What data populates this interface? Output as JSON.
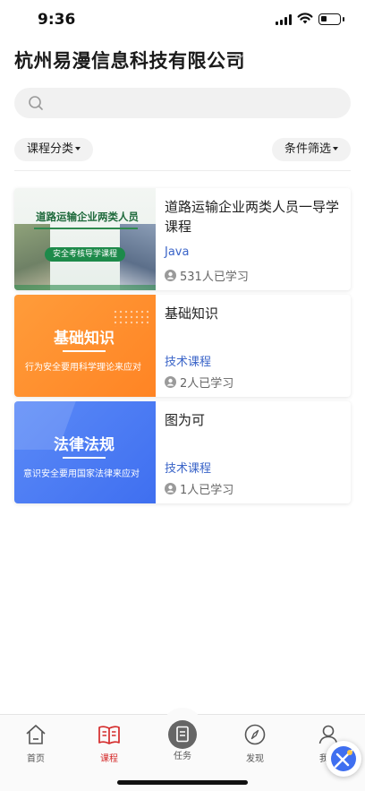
{
  "status_bar": {
    "time": "9:36",
    "battery_level": 0.35
  },
  "header": {
    "company_name": "杭州易漫信息科技有限公司",
    "chevron_icon": "chevron-down-icon"
  },
  "search": {
    "icon": "search-icon"
  },
  "filters": {
    "category_label": "课程分类",
    "condition_label": "条件筛选"
  },
  "courses": [
    {
      "title": "道路运输企业两类人员一导学课程",
      "tag": "Java",
      "learners": "531人已学习",
      "thumb_heading": "道路运输企业两类人员",
      "thumb_pill": "安全考核导学课程"
    },
    {
      "title": "基础知识",
      "tag": "技术课程",
      "learners": "2人已学习",
      "thumb_heading": "基础知识",
      "thumb_sub": "行为安全要用科学理论来应对"
    },
    {
      "title": "图为可",
      "tag": "技术课程",
      "learners": "1人已学习",
      "thumb_heading": "法律法规",
      "thumb_sub": "意识安全要用国家法律来应对"
    }
  ],
  "tabs": [
    {
      "label": "首页",
      "icon": "home-icon",
      "active": false
    },
    {
      "label": "课程",
      "icon": "book-icon",
      "active": true
    },
    {
      "label": "任务",
      "icon": "task-icon",
      "active": false
    },
    {
      "label": "发现",
      "icon": "compass-icon",
      "active": false
    },
    {
      "label": "我的",
      "icon": "user-icon",
      "active": false
    }
  ],
  "colors": {
    "accent_red": "#d42a2a",
    "tag_blue": "#3a64c8"
  }
}
